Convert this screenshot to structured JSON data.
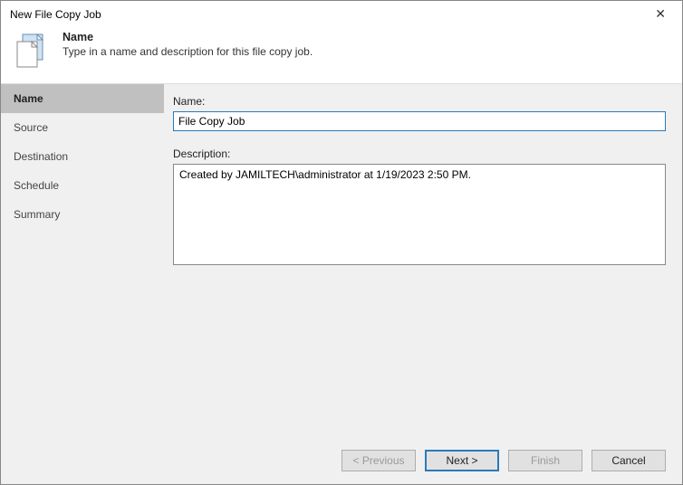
{
  "window": {
    "title": "New File Copy Job"
  },
  "header": {
    "title": "Name",
    "subtitle": "Type in a name and description for this file copy job."
  },
  "sidebar": {
    "items": [
      {
        "label": "Name",
        "active": true
      },
      {
        "label": "Source",
        "active": false
      },
      {
        "label": "Destination",
        "active": false
      },
      {
        "label": "Schedule",
        "active": false
      },
      {
        "label": "Summary",
        "active": false
      }
    ]
  },
  "form": {
    "name_label": "Name:",
    "name_value": "File Copy Job",
    "description_label": "Description:",
    "description_value": "Created by JAMILTECH\\administrator at 1/19/2023 2:50 PM."
  },
  "buttons": {
    "previous": "< Previous",
    "next": "Next >",
    "finish": "Finish",
    "cancel": "Cancel"
  }
}
